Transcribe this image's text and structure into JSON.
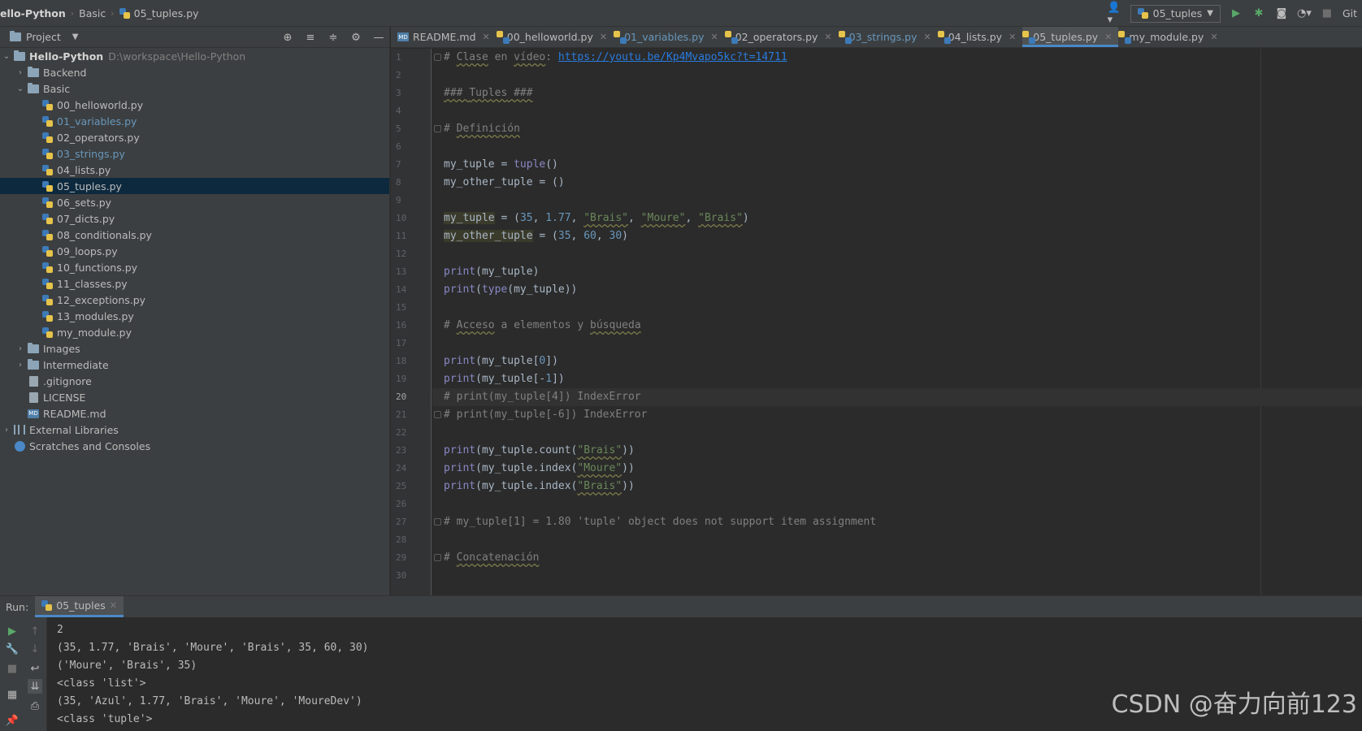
{
  "navbar": {
    "project": "ello-Python",
    "folder": "Basic",
    "file": "05_tuples.py",
    "run_config": "05_tuples",
    "git_label": "Git"
  },
  "project_panel": {
    "title": "Project",
    "root": "Hello-Python",
    "root_path": "D:\\workspace\\Hello-Python",
    "items": [
      {
        "label": "Backend",
        "type": "folder",
        "depth": 1,
        "arrow": "›",
        "modified": false
      },
      {
        "label": "Basic",
        "type": "folder",
        "depth": 1,
        "arrow": "⌄",
        "modified": false
      },
      {
        "label": "00_helloworld.py",
        "type": "py",
        "depth": 2,
        "arrow": "",
        "modified": false
      },
      {
        "label": "01_variables.py",
        "type": "py",
        "depth": 2,
        "arrow": "",
        "modified": true
      },
      {
        "label": "02_operators.py",
        "type": "py",
        "depth": 2,
        "arrow": "",
        "modified": false
      },
      {
        "label": "03_strings.py",
        "type": "py",
        "depth": 2,
        "arrow": "",
        "modified": true
      },
      {
        "label": "04_lists.py",
        "type": "py",
        "depth": 2,
        "arrow": "",
        "modified": false
      },
      {
        "label": "05_tuples.py",
        "type": "py",
        "depth": 2,
        "arrow": "",
        "modified": false,
        "selected": true
      },
      {
        "label": "06_sets.py",
        "type": "py",
        "depth": 2,
        "arrow": "",
        "modified": false
      },
      {
        "label": "07_dicts.py",
        "type": "py",
        "depth": 2,
        "arrow": "",
        "modified": false
      },
      {
        "label": "08_conditionals.py",
        "type": "py",
        "depth": 2,
        "arrow": "",
        "modified": false
      },
      {
        "label": "09_loops.py",
        "type": "py",
        "depth": 2,
        "arrow": "",
        "modified": false
      },
      {
        "label": "10_functions.py",
        "type": "py",
        "depth": 2,
        "arrow": "",
        "modified": false
      },
      {
        "label": "11_classes.py",
        "type": "py",
        "depth": 2,
        "arrow": "",
        "modified": false
      },
      {
        "label": "12_exceptions.py",
        "type": "py",
        "depth": 2,
        "arrow": "",
        "modified": false
      },
      {
        "label": "13_modules.py",
        "type": "py",
        "depth": 2,
        "arrow": "",
        "modified": false
      },
      {
        "label": "my_module.py",
        "type": "py",
        "depth": 2,
        "arrow": "",
        "modified": false
      },
      {
        "label": "Images",
        "type": "folder",
        "depth": 1,
        "arrow": "›",
        "modified": false
      },
      {
        "label": "Intermediate",
        "type": "folder",
        "depth": 1,
        "arrow": "›",
        "modified": false
      },
      {
        "label": ".gitignore",
        "type": "file",
        "depth": 1,
        "arrow": "",
        "modified": false
      },
      {
        "label": "LICENSE",
        "type": "file",
        "depth": 1,
        "arrow": "",
        "modified": false
      },
      {
        "label": "README.md",
        "type": "md",
        "depth": 1,
        "arrow": "",
        "modified": false
      },
      {
        "label": "External Libraries",
        "type": "lib",
        "depth": 0,
        "arrow": "›",
        "modified": false
      },
      {
        "label": "Scratches and Consoles",
        "type": "scratch",
        "depth": 0,
        "arrow": "",
        "modified": false
      }
    ]
  },
  "tabs": [
    {
      "label": "README.md",
      "icon": "md",
      "active": false,
      "modified": false
    },
    {
      "label": "00_helloworld.py",
      "icon": "py",
      "active": false,
      "modified": false
    },
    {
      "label": "01_variables.py",
      "icon": "py",
      "active": false,
      "modified": true
    },
    {
      "label": "02_operators.py",
      "icon": "py",
      "active": false,
      "modified": false
    },
    {
      "label": "03_strings.py",
      "icon": "py",
      "active": false,
      "modified": true
    },
    {
      "label": "04_lists.py",
      "icon": "py",
      "active": false,
      "modified": false
    },
    {
      "label": "05_tuples.py",
      "icon": "py",
      "active": true,
      "modified": false
    },
    {
      "label": "my_module.py",
      "icon": "py",
      "active": false,
      "modified": false
    }
  ],
  "editor": {
    "current_line": 20,
    "lines": [
      [
        {
          "t": "# ",
          "c": "cmt"
        },
        {
          "t": "Clase",
          "c": "cmt ul"
        },
        {
          "t": " en ",
          "c": "cmt"
        },
        {
          "t": "vídeo",
          "c": "cmt ul"
        },
        {
          "t": ": ",
          "c": "cmt"
        },
        {
          "t": "https://youtu.be/Kp4Mvapo5kc?t=14711",
          "c": "link"
        }
      ],
      [],
      [
        {
          "t": "### ",
          "c": "cmt ul"
        },
        {
          "t": "Tuples",
          "c": "cmt ul"
        },
        {
          "t": " ###",
          "c": "cmt ul"
        }
      ],
      [],
      [
        {
          "t": "# ",
          "c": "cmt"
        },
        {
          "t": "Definición",
          "c": "cmt ul"
        }
      ],
      [],
      [
        {
          "t": "my_tuple = ",
          "c": ""
        },
        {
          "t": "tuple",
          "c": "bi"
        },
        {
          "t": "()",
          "c": ""
        }
      ],
      [
        {
          "t": "my_other_tuple = ()",
          "c": ""
        }
      ],
      [],
      [
        {
          "t": "my_tuple",
          "c": "hl-var"
        },
        {
          "t": " = (",
          "c": ""
        },
        {
          "t": "35",
          "c": "num"
        },
        {
          "t": ", ",
          "c": ""
        },
        {
          "t": "1.77",
          "c": "num"
        },
        {
          "t": ", ",
          "c": ""
        },
        {
          "t": "\"Brais\"",
          "c": "str ul"
        },
        {
          "t": ", ",
          "c": ""
        },
        {
          "t": "\"Moure\"",
          "c": "str ul"
        },
        {
          "t": ", ",
          "c": ""
        },
        {
          "t": "\"Brais\"",
          "c": "str ul"
        },
        {
          "t": ")",
          "c": ""
        }
      ],
      [
        {
          "t": "my_other_tuple",
          "c": "hl-var"
        },
        {
          "t": " = (",
          "c": ""
        },
        {
          "t": "35",
          "c": "num"
        },
        {
          "t": ", ",
          "c": ""
        },
        {
          "t": "60",
          "c": "num"
        },
        {
          "t": ", ",
          "c": ""
        },
        {
          "t": "30",
          "c": "num"
        },
        {
          "t": ")",
          "c": ""
        }
      ],
      [],
      [
        {
          "t": "print",
          "c": "bi"
        },
        {
          "t": "(my_tuple)",
          "c": ""
        }
      ],
      [
        {
          "t": "print",
          "c": "bi"
        },
        {
          "t": "(",
          "c": ""
        },
        {
          "t": "type",
          "c": "bi"
        },
        {
          "t": "(my_tuple))",
          "c": ""
        }
      ],
      [],
      [
        {
          "t": "# ",
          "c": "cmt"
        },
        {
          "t": "Acceso",
          "c": "cmt ul"
        },
        {
          "t": " a elementos y ",
          "c": "cmt"
        },
        {
          "t": "búsqueda",
          "c": "cmt ul"
        }
      ],
      [],
      [
        {
          "t": "print",
          "c": "bi"
        },
        {
          "t": "(my_tuple[",
          "c": ""
        },
        {
          "t": "0",
          "c": "num"
        },
        {
          "t": "])",
          "c": ""
        }
      ],
      [
        {
          "t": "print",
          "c": "bi"
        },
        {
          "t": "(my_tuple[-",
          "c": ""
        },
        {
          "t": "1",
          "c": "num"
        },
        {
          "t": "])",
          "c": ""
        }
      ],
      [
        {
          "t": "# print(my_tuple[4]) IndexError",
          "c": "cmt"
        }
      ],
      [
        {
          "t": "# print(my_tuple[-6]) IndexError",
          "c": "cmt"
        }
      ],
      [],
      [
        {
          "t": "print",
          "c": "bi"
        },
        {
          "t": "(my_tuple.count(",
          "c": ""
        },
        {
          "t": "\"Brais\"",
          "c": "str ul"
        },
        {
          "t": "))",
          "c": ""
        }
      ],
      [
        {
          "t": "print",
          "c": "bi"
        },
        {
          "t": "(my_tuple.index(",
          "c": ""
        },
        {
          "t": "\"Moure\"",
          "c": "str ul"
        },
        {
          "t": "))",
          "c": ""
        }
      ],
      [
        {
          "t": "print",
          "c": "bi"
        },
        {
          "t": "(my_tuple.index(",
          "c": ""
        },
        {
          "t": "\"Brais\"",
          "c": "str ul"
        },
        {
          "t": "))",
          "c": ""
        }
      ],
      [],
      [
        {
          "t": "# my_tuple[1] = 1.80 'tuple' object does not support item assignment",
          "c": "cmt"
        }
      ],
      [],
      [
        {
          "t": "# ",
          "c": "cmt"
        },
        {
          "t": "Concatenación",
          "c": "cmt ul"
        }
      ],
      []
    ],
    "fold_lines": [
      1,
      5,
      20,
      21,
      27,
      29
    ]
  },
  "run": {
    "label": "Run:",
    "tab": "05_tuples",
    "output": [
      "2",
      "(35, 1.77, 'Brais', 'Moure', 'Brais', 35, 60, 30)",
      "('Moure', 'Brais', 35)",
      "<class 'list'>",
      "(35, 'Azul', 1.77, 'Brais', 'Moure', 'MoureDev')",
      "<class 'tuple'>"
    ]
  },
  "watermark": "CSDN @奋力向前123",
  "colors": {
    "accent": "#4a88c7",
    "comment": "#808080",
    "string": "#6a8759",
    "number": "#6897bb",
    "builtin": "#8888c6",
    "run_green": "#59a869"
  }
}
